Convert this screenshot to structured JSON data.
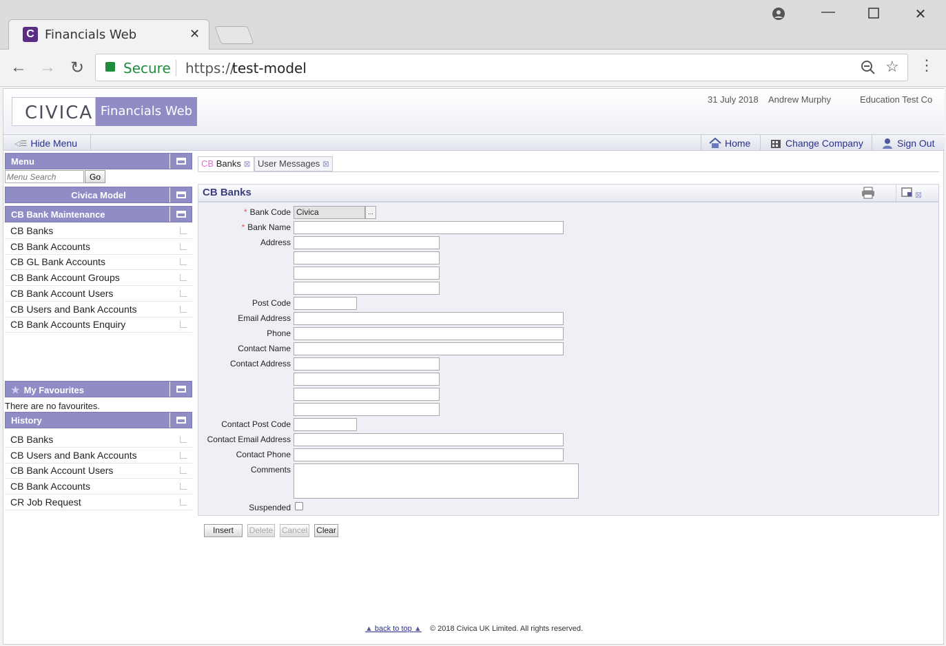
{
  "browser": {
    "tab_title": "Financials Web",
    "tab_close": "✕",
    "secure_label": "Secure",
    "url_scheme": "https://",
    "url_host": "test-model"
  },
  "header": {
    "logo": "CIVICA",
    "brand": "Financials Web",
    "date": "31 July 2018",
    "user": "Andrew Murphy",
    "company": "Education Test Co"
  },
  "bar": {
    "hide_menu": "Hide Menu",
    "home": "Home",
    "change_company": "Change Company",
    "sign_out": "Sign Out"
  },
  "sidebar": {
    "menu_title": "Menu",
    "search_placeholder": "Menu Search",
    "go_label": "Go",
    "model_title": "Civica Model",
    "section_title": "CB Bank Maintenance",
    "items": [
      {
        "label": "CB Banks"
      },
      {
        "label": "CB Bank Accounts"
      },
      {
        "label": "CB GL Bank Accounts"
      },
      {
        "label": "CB Bank Account Groups"
      },
      {
        "label": "CB Bank Account Users"
      },
      {
        "label": "CB Users and Bank Accounts"
      },
      {
        "label": "CB Bank Accounts Enquiry"
      }
    ],
    "favourites_title": "My Favourites",
    "favourites_empty": "There are no favourites.",
    "history_title": "History",
    "history": [
      {
        "label": "CB Banks"
      },
      {
        "label": "CB Users and Bank Accounts"
      },
      {
        "label": "CB Bank Account Users"
      },
      {
        "label": "CB Bank Accounts"
      },
      {
        "label": "CR Job Request"
      }
    ]
  },
  "tabs": [
    {
      "prefix": "CB",
      "label": "Banks",
      "close": "⊠"
    },
    {
      "label": "User Messages",
      "close": "⊠"
    }
  ],
  "panel": {
    "title": "CB Banks"
  },
  "form": {
    "bank_code_label": "Bank Code",
    "bank_code_value": "Civica",
    "lookup_label": "...",
    "required_mark": "*",
    "bank_name_label": "Bank Name",
    "address_label": "Address",
    "post_code_label": "Post Code",
    "email_label": "Email Address",
    "phone_label": "Phone",
    "contact_name_label": "Contact Name",
    "contact_address_label": "Contact Address",
    "contact_post_code_label": "Contact Post Code",
    "contact_email_label": "Contact Email Address",
    "contact_phone_label": "Contact Phone",
    "comments_label": "Comments",
    "suspended_label": "Suspended"
  },
  "buttons": {
    "insert": "Insert",
    "delete": "Delete",
    "cancel": "Cancel",
    "clear": "Clear"
  },
  "footer": {
    "back_to_top": "back to top",
    "copyright": "© 2018 Civica UK Limited. All rights reserved."
  }
}
